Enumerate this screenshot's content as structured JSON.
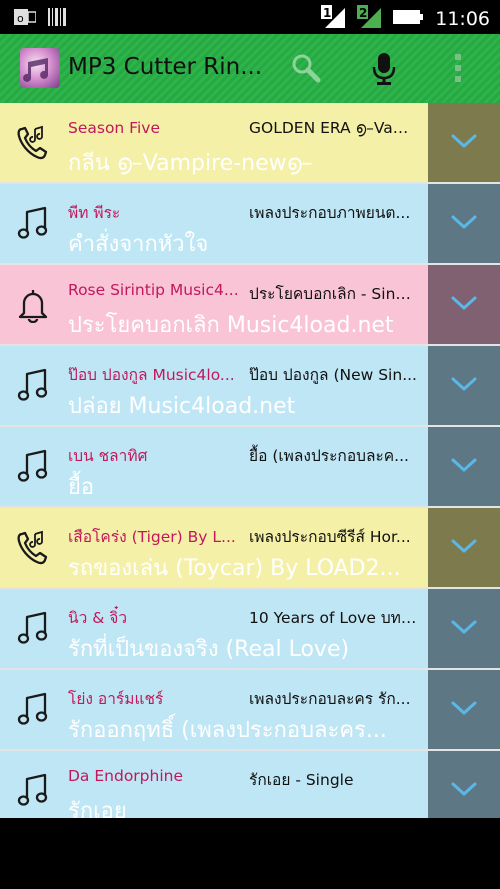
{
  "status_bar": {
    "time": "11:06",
    "icons": [
      "outlook-notification-icon",
      "barcode-notification-icon",
      "sim1-signal-icon",
      "sim2-signal-icon",
      "battery-icon"
    ],
    "sim1_label": "1",
    "sim2_label": "2"
  },
  "app_bar": {
    "title": "MP3 Cutter Rin...",
    "icons": [
      "app-logo-icon",
      "search-icon",
      "microphone-icon",
      "overflow-menu-icon"
    ],
    "accent": "#2db44a"
  },
  "colors": {
    "artist_text": "#c2185b",
    "ringtone_row": "#f5f0a8",
    "music_row": "#bfe6f5",
    "notification_row": "#f9c4d6"
  },
  "songs": [
    {
      "type": "ringtone",
      "icon": "phone-ringtone-icon",
      "artist": "Season Five",
      "album": "GOLDEN ERA ൭–Vam...",
      "title": "กลีน ൭–Vampire-new൭–"
    },
    {
      "type": "music",
      "icon": "music-note-icon",
      "artist": "พีท พีระ",
      "album": "เพลงประกอบภาพยนต...",
      "title": "คำสั่งจากหัวใจ"
    },
    {
      "type": "notification",
      "icon": "bell-icon",
      "artist": "Rose Sirintip Music4...",
      "album": "ประโยคบอกเลิก - Sing...",
      "title": "ประโยคบอกเลิก Music4load.net"
    },
    {
      "type": "music",
      "icon": "music-note-icon",
      "artist": "ป๊อบ ปองกูล Music4lo...",
      "album": "ป๊อบ ปองกูล (New Sin...",
      "title": "ปล่อย Music4load.net"
    },
    {
      "type": "music",
      "icon": "music-note-icon",
      "artist": "เบน ชลาทิศ",
      "album": "ยื้อ (เพลงประกอบละค...",
      "title": "ยื้อ"
    },
    {
      "type": "ringtone",
      "icon": "phone-ringtone-icon",
      "artist": "เสือโคร่ง (Tiger) By L...",
      "album": "เพลงประกอบซีรีส์ Hor...",
      "title": "รถของเล่น (Toycar) By LOAD2..."
    },
    {
      "type": "music",
      "icon": "music-note-icon",
      "artist": "นิว & จิ๋ว",
      "album": "10 Years of Love บทเ...",
      "title": "รักที่เป็นของจริง (Real Love)"
    },
    {
      "type": "music",
      "icon": "music-note-icon",
      "artist": "โย่ง อาร์มแชร์",
      "album": "เพลงประกอบละคร รัก...",
      "title": "รักออกฤทธิ์ (เพลงประกอบละคร..."
    },
    {
      "type": "music",
      "icon": "music-note-icon",
      "artist": "Da Endorphine",
      "album": "รักเอย - Single",
      "title": "รักเอย"
    }
  ]
}
